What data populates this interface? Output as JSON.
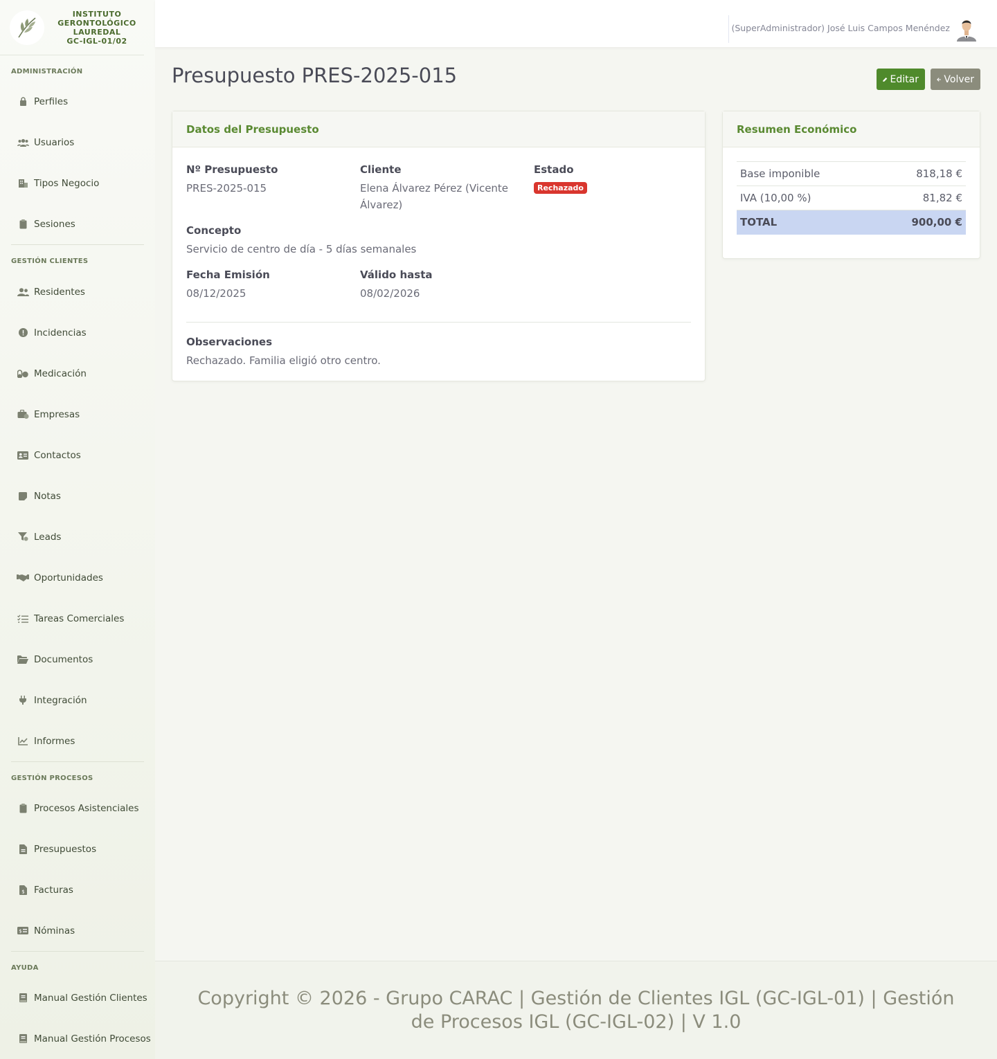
{
  "brand": {
    "line1": "INSTITUTO",
    "line2": "GERONTOLÓGICO",
    "line3": "LAUREDAL",
    "line4": "GC-IGL-01/02"
  },
  "sidebar": {
    "sections": [
      {
        "title": "ADMINISTRACIÓN",
        "items": [
          {
            "label": "Perfiles",
            "icon": "lock-icon"
          },
          {
            "label": "Usuarios",
            "icon": "users-icon"
          },
          {
            "label": "Tipos Negocio",
            "icon": "building-icon"
          },
          {
            "label": "Sesiones",
            "icon": "clipboard-icon"
          }
        ]
      },
      {
        "title": "GESTIÓN CLIENTES",
        "items": [
          {
            "label": "Residentes",
            "icon": "user-group-icon"
          },
          {
            "label": "Incidencias",
            "icon": "alert-icon"
          },
          {
            "label": "Medicación",
            "icon": "pills-icon"
          },
          {
            "label": "Empresas",
            "icon": "briefcase-icon"
          },
          {
            "label": "Contactos",
            "icon": "contact-card-icon"
          },
          {
            "label": "Notas",
            "icon": "note-icon"
          },
          {
            "label": "Leads",
            "icon": "funnel-icon"
          },
          {
            "label": "Oportunidades",
            "icon": "handshake-icon"
          },
          {
            "label": "Tareas Comerciales",
            "icon": "task-list-icon"
          },
          {
            "label": "Documentos",
            "icon": "folder-icon"
          },
          {
            "label": "Integración",
            "icon": "plug-icon"
          },
          {
            "label": "Informes",
            "icon": "chart-line-icon"
          }
        ]
      },
      {
        "title": "GESTIÓN PROCESOS",
        "items": [
          {
            "label": "Procesos Asistenciales",
            "icon": "clipboard-icon"
          },
          {
            "label": "Presupuestos",
            "icon": "file-icon"
          },
          {
            "label": "Facturas",
            "icon": "invoice-icon"
          },
          {
            "label": "Nóminas",
            "icon": "money-icon"
          }
        ]
      },
      {
        "title": "AYUDA",
        "items": [
          {
            "label": "Manual Gestión Clientes",
            "icon": "book-icon"
          },
          {
            "label": "Manual Gestión Procesos",
            "icon": "book-icon"
          }
        ]
      }
    ]
  },
  "topbar": {
    "user": "(SuperAdministrador) José Luis Campos Menéndez"
  },
  "page": {
    "title": "Presupuesto PRES-2025-015",
    "edit_label": "Editar",
    "back_label": "Volver"
  },
  "datos": {
    "header": "Datos del Presupuesto",
    "numero_label": "Nº Presupuesto",
    "numero": "PRES-2025-015",
    "cliente_label": "Cliente",
    "cliente": "Elena Álvarez Pérez (Vicente Álvarez)",
    "estado_label": "Estado",
    "estado": "Rechazado",
    "concepto_label": "Concepto",
    "concepto": "Servicio de centro de día - 5 días semanales",
    "fecha_label": "Fecha Emisión",
    "fecha": "08/12/2025",
    "valido_label": "Válido hasta",
    "valido": "08/02/2026",
    "obs_label": "Observaciones",
    "obs": "Rechazado. Familia eligió otro centro."
  },
  "resumen": {
    "header": "Resumen Económico",
    "base_label": "Base imponible",
    "base": "818,18 €",
    "iva_label": "IVA (10,00 %)",
    "iva": "81,82 €",
    "total_label": "TOTAL",
    "total": "900,00 €"
  },
  "footer": {
    "text": "Copyright © 2026 - Grupo CARAC | Gestión de Clientes IGL (GC-IGL-01) | Gestión de Procesos IGL (GC-IGL-02) | V 1.0"
  },
  "colors": {
    "accent": "#4f8a2c",
    "danger": "#d9362e",
    "total_bg": "#c9d6f2"
  }
}
